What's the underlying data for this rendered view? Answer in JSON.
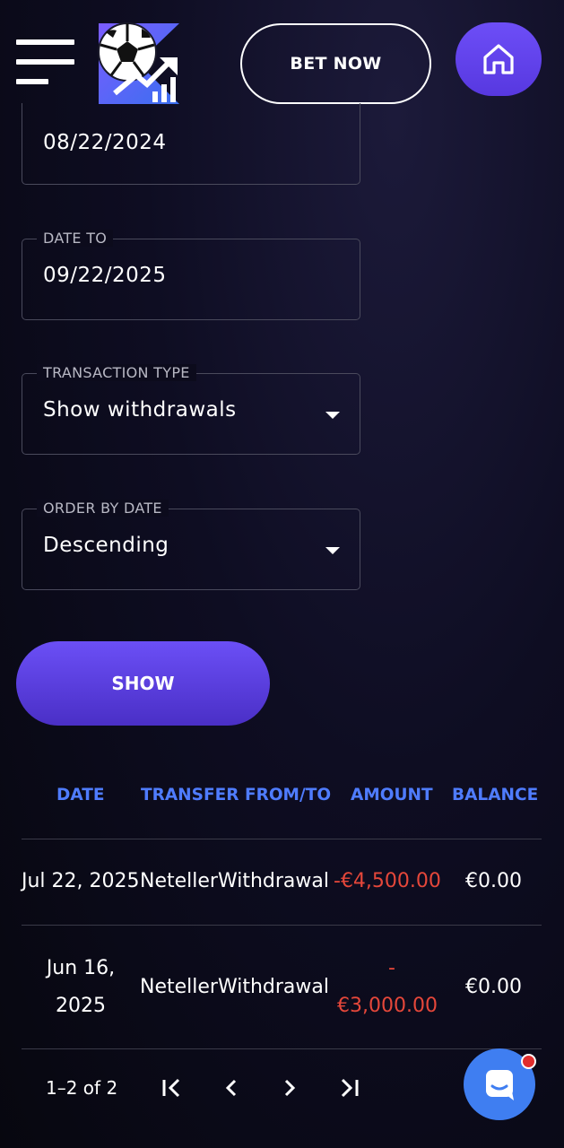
{
  "header": {
    "bet_now_label": "BET NOW",
    "icons": [
      "menu-icon",
      "logo",
      "home-icon"
    ]
  },
  "filters": {
    "date_from": {
      "value": "08/22/2024"
    },
    "date_to": {
      "label": "DATE TO",
      "value": "09/22/2025"
    },
    "transaction_type": {
      "label": "TRANSACTION TYPE",
      "value": "Show withdrawals"
    },
    "order_by_date": {
      "label": "ORDER BY DATE",
      "value": "Descending"
    },
    "show_label": "SHOW"
  },
  "table": {
    "headers": {
      "date": "DATE",
      "transfer": "TRANSFER FROM/TO",
      "amount": "AMOUNT",
      "balance": "BALANCE"
    },
    "rows": [
      {
        "date": "Jul 22, 2025",
        "transfer": "NetellerWithdrawal",
        "amount": "-€4,500.00",
        "balance": "€0.00"
      },
      {
        "date_line1": "Jun 16,",
        "date_line2": "2025",
        "transfer": "NetellerWithdrawal",
        "amount_line1": "-",
        "amount_line2": "€3,000.00",
        "balance": "€0.00"
      }
    ]
  },
  "pagination": {
    "range_label": "1–2 of 2"
  },
  "colors": {
    "accent_purple": "#6b4ff6",
    "header_blue": "#4f7cff",
    "negative_red": "#e5473a",
    "chat_blue": "#3f7ef1"
  }
}
